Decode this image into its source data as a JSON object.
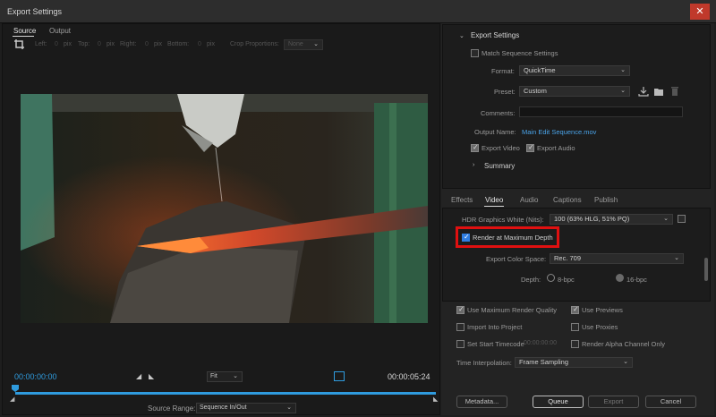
{
  "window": {
    "title": "Export Settings",
    "close_glyph": "✕"
  },
  "left": {
    "tabs": [
      "Source",
      "Output"
    ],
    "crop": {
      "left": "Left:",
      "top": "Top:",
      "right": "Right:",
      "bottom": "Bottom:",
      "unit": "pix",
      "zero": "0",
      "proportions_label": "Crop Proportions:",
      "proportions_value": "None"
    },
    "timeline": {
      "start": "00:00:00:00",
      "end": "00:00:05:24",
      "fit": "Fit",
      "source_range_label": "Source Range:",
      "source_range_value": "Sequence In/Out"
    }
  },
  "export_settings": {
    "header": "Export Settings",
    "match_sequence": "Match Sequence Settings",
    "format_label": "Format:",
    "format_value": "QuickTime",
    "preset_label": "Preset:",
    "preset_value": "Custom",
    "comments_label": "Comments:",
    "output_name_label": "Output Name:",
    "output_name_value": "Main Edit Sequence.mov",
    "export_video": "Export Video",
    "export_audio": "Export Audio",
    "summary": "Summary"
  },
  "video_tabs": [
    "Effects",
    "Video",
    "Audio",
    "Captions",
    "Publish"
  ],
  "video": {
    "hdr_label": "HDR Graphics White (Nits):",
    "hdr_value": "100 (63% HLG, 51% PQ)",
    "render_max_depth": "Render at Maximum Depth",
    "color_space_label": "Export Color Space:",
    "color_space_value": "Rec. 709",
    "depth_label": "Depth:",
    "depth_8": "8-bpc",
    "depth_16": "16-bpc"
  },
  "bottom_options": {
    "use_max_render": "Use Maximum Render Quality",
    "use_previews": "Use Previews",
    "import_into_project": "Import Into Project",
    "use_proxies": "Use Proxies",
    "set_start_timecode": "Set Start Timecode",
    "start_timecode_value": "00:00:00:00",
    "render_alpha": "Render Alpha Channel Only",
    "time_interp_label": "Time Interpolation:",
    "time_interp_value": "Frame Sampling"
  },
  "buttons": {
    "metadata": "Metadata...",
    "queue": "Queue",
    "export": "Export",
    "cancel": "Cancel"
  },
  "colors": {
    "accent": "#2f9bde",
    "highlight_box": "#e01010",
    "checkbox_on": "#2f7de1"
  }
}
